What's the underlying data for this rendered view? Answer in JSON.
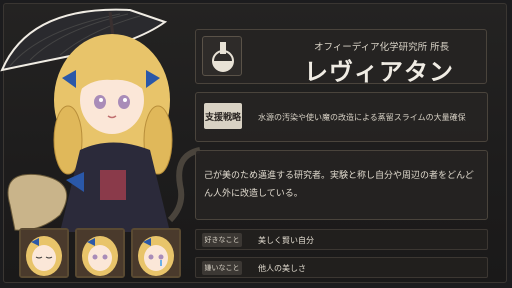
{
  "character": {
    "affiliation": "オフィーディア化学研究所 所長",
    "name": "レヴィアタン",
    "support_label": "支援戦略",
    "support_text": "水源の汚染や使い魔の改造による蒸留スライムの大量確保",
    "description": "己が美のため邁進する研究者。実験と称し自分や周辺の者をどんどん人外に改造している。",
    "likes_label": "好きなこと",
    "likes_value": "美しく賢い自分",
    "dislikes_label": "嫌いなこと",
    "dislikes_value": "他人の美しさ",
    "icon": "flask-icon"
  },
  "thumbnails": [
    "expression-sleepy",
    "expression-neutral",
    "expression-crying"
  ],
  "colors": {
    "hair": "#e8c46a",
    "ribbon": "#2a58a8",
    "dress": "#2b2a3a",
    "panel_border": "#4a443c"
  }
}
